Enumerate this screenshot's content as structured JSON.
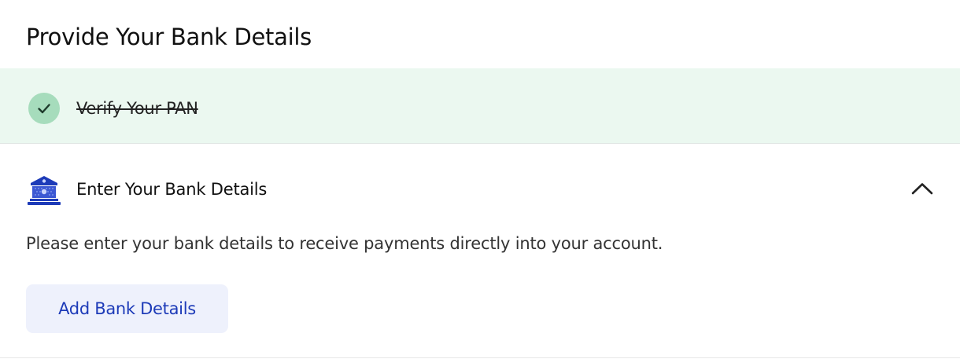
{
  "page": {
    "title": "Provide Your Bank Details"
  },
  "steps": {
    "completed": {
      "label": "Verify Your PAN",
      "status": "done",
      "icon": "check-icon",
      "status_color": "#a6dcbc",
      "background_color": "#ebf8f0"
    },
    "active": {
      "label": "Enter Your Bank Details",
      "icon": "bank-icon",
      "icon_color": "#1d3bb8",
      "expanded": true,
      "toggle_icon": "chevron-up-icon",
      "description": "Please enter your bank details to receive payments directly into your account.",
      "button_label": "Add Bank Details",
      "button_color": "#1d3bb8",
      "button_background": "#eef1fc"
    }
  }
}
